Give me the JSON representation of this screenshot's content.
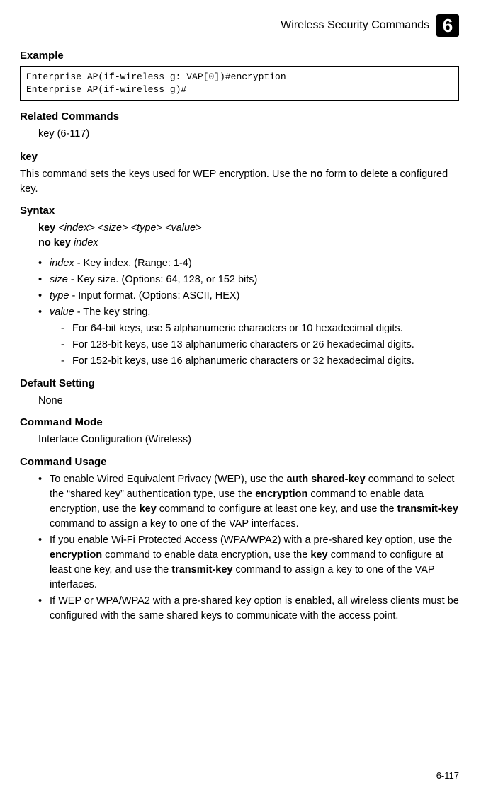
{
  "header": {
    "title": "Wireless Security Commands",
    "chapter": "6"
  },
  "section_example": {
    "heading": "Example",
    "code": "Enterprise AP(if-wireless g: VAP[0])#encryption\nEnterprise AP(if-wireless g)#"
  },
  "section_related": {
    "heading": "Related Commands",
    "text": "key (6-117)"
  },
  "section_key": {
    "heading": "key",
    "desc_pre": "This command sets the keys used for WEP encryption. Use the ",
    "desc_bold": "no",
    "desc_post": " form to delete a configured key."
  },
  "section_syntax": {
    "heading": "Syntax",
    "line1_bold": "key",
    "line1_rest": " <index> <size> <type> <value>",
    "line2_bold": "no key",
    "line2_rest": " index",
    "params": [
      {
        "name": "index",
        "desc": " - Key index. (Range: 1-4)"
      },
      {
        "name": "size",
        "desc": " - Key size. (Options: 64, 128, or 152 bits)"
      },
      {
        "name": "type",
        "desc": " - Input format. (Options: ASCII, HEX)"
      },
      {
        "name": "value",
        "desc": " - The key string."
      }
    ],
    "sub": [
      "For 64-bit keys, use 5 alphanumeric characters or 10 hexadecimal digits.",
      "For 128-bit keys, use 13 alphanumeric characters or 26 hexadecimal digits.",
      "For 152-bit keys, use 16 alphanumeric characters or 32 hexadecimal digits."
    ]
  },
  "section_default": {
    "heading": "Default Setting",
    "text": "None"
  },
  "section_mode": {
    "heading": "Command Mode",
    "text": "Interface Configuration (Wireless)"
  },
  "section_usage": {
    "heading": "Command Usage",
    "items": [
      {
        "parts": [
          {
            "t": "To enable Wired Equivalent Privacy (WEP), use the "
          },
          {
            "b": "auth shared-key"
          },
          {
            "t": " command to select the “shared key” authentication type, use the "
          },
          {
            "b": "encryption"
          },
          {
            "t": " command to enable data encryption, use the "
          },
          {
            "b": "key"
          },
          {
            "t": " command to configure at least one key, and use the "
          },
          {
            "b": "transmit-key"
          },
          {
            "t": " command to assign a key to one of the VAP interfaces."
          }
        ]
      },
      {
        "parts": [
          {
            "t": "If you enable Wi-Fi Protected Access (WPA/WPA2) with a pre-shared key option, use the "
          },
          {
            "b": "encryption"
          },
          {
            "t": " command to enable data encryption, use the "
          },
          {
            "b": "key"
          },
          {
            "t": " command to configure at least one key, and use the "
          },
          {
            "b": "transmit-key"
          },
          {
            "t": " command to assign a key to one of the VAP interfaces."
          }
        ]
      },
      {
        "parts": [
          {
            "t": "If WEP or WPA/WPA2 with a pre-shared key option is enabled, all wireless clients must be configured with the same shared keys to communicate with the access point."
          }
        ]
      }
    ]
  },
  "footer": {
    "page": "6-117"
  }
}
